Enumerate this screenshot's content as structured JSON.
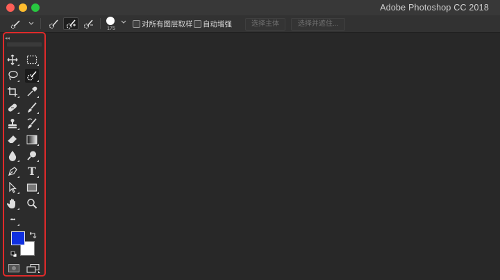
{
  "window": {
    "title": "Adobe Photoshop CC 2018"
  },
  "options_bar": {
    "brush_size": "175",
    "sample_all_layers_label": "对所有图层取样",
    "auto_enhance_label": "自动增强",
    "select_subject_label": "选择主体",
    "select_and_mask_label": "选择并遮住...",
    "sample_all_layers_checked": false,
    "auto_enhance_checked": false
  },
  "toolbox": {
    "tools": [
      {
        "name": "move-tool",
        "icon": "move-icon"
      },
      {
        "name": "marquee-tool",
        "icon": "rect-marquee-icon"
      },
      {
        "name": "lasso-tool",
        "icon": "lasso-icon"
      },
      {
        "name": "quick-selection-tool",
        "icon": "quick-selection-icon",
        "active": true
      },
      {
        "name": "crop-tool",
        "icon": "crop-icon"
      },
      {
        "name": "eyedropper-tool",
        "icon": "eyedropper-icon"
      },
      {
        "name": "healing-brush-tool",
        "icon": "bandage-icon"
      },
      {
        "name": "brush-tool",
        "icon": "brush-icon"
      },
      {
        "name": "clone-stamp-tool",
        "icon": "stamp-icon"
      },
      {
        "name": "history-brush-tool",
        "icon": "history-brush-icon"
      },
      {
        "name": "eraser-tool",
        "icon": "eraser-icon"
      },
      {
        "name": "gradient-tool",
        "icon": "gradient-icon"
      },
      {
        "name": "blur-tool",
        "icon": "drop-icon"
      },
      {
        "name": "dodge-tool",
        "icon": "dodge-icon"
      },
      {
        "name": "pen-tool",
        "icon": "pen-icon"
      },
      {
        "name": "type-tool",
        "icon": "type-icon",
        "glyph": "T"
      },
      {
        "name": "path-selection-tool",
        "icon": "arrow-icon"
      },
      {
        "name": "rectangle-tool",
        "icon": "rectangle-icon"
      },
      {
        "name": "hand-tool",
        "icon": "hand-icon"
      },
      {
        "name": "zoom-tool",
        "icon": "magnifier-icon"
      },
      {
        "name": "edit-toolbar",
        "icon": "ellipsis-icon",
        "glyph": "•••"
      }
    ],
    "foreground_color": "#1030e0",
    "background_color": "#ffffff",
    "highlight_outline_color": "#e02a2a"
  },
  "colors": {
    "titlebar": "#383838",
    "workspace": "#282828",
    "options_bar": "#323232"
  }
}
